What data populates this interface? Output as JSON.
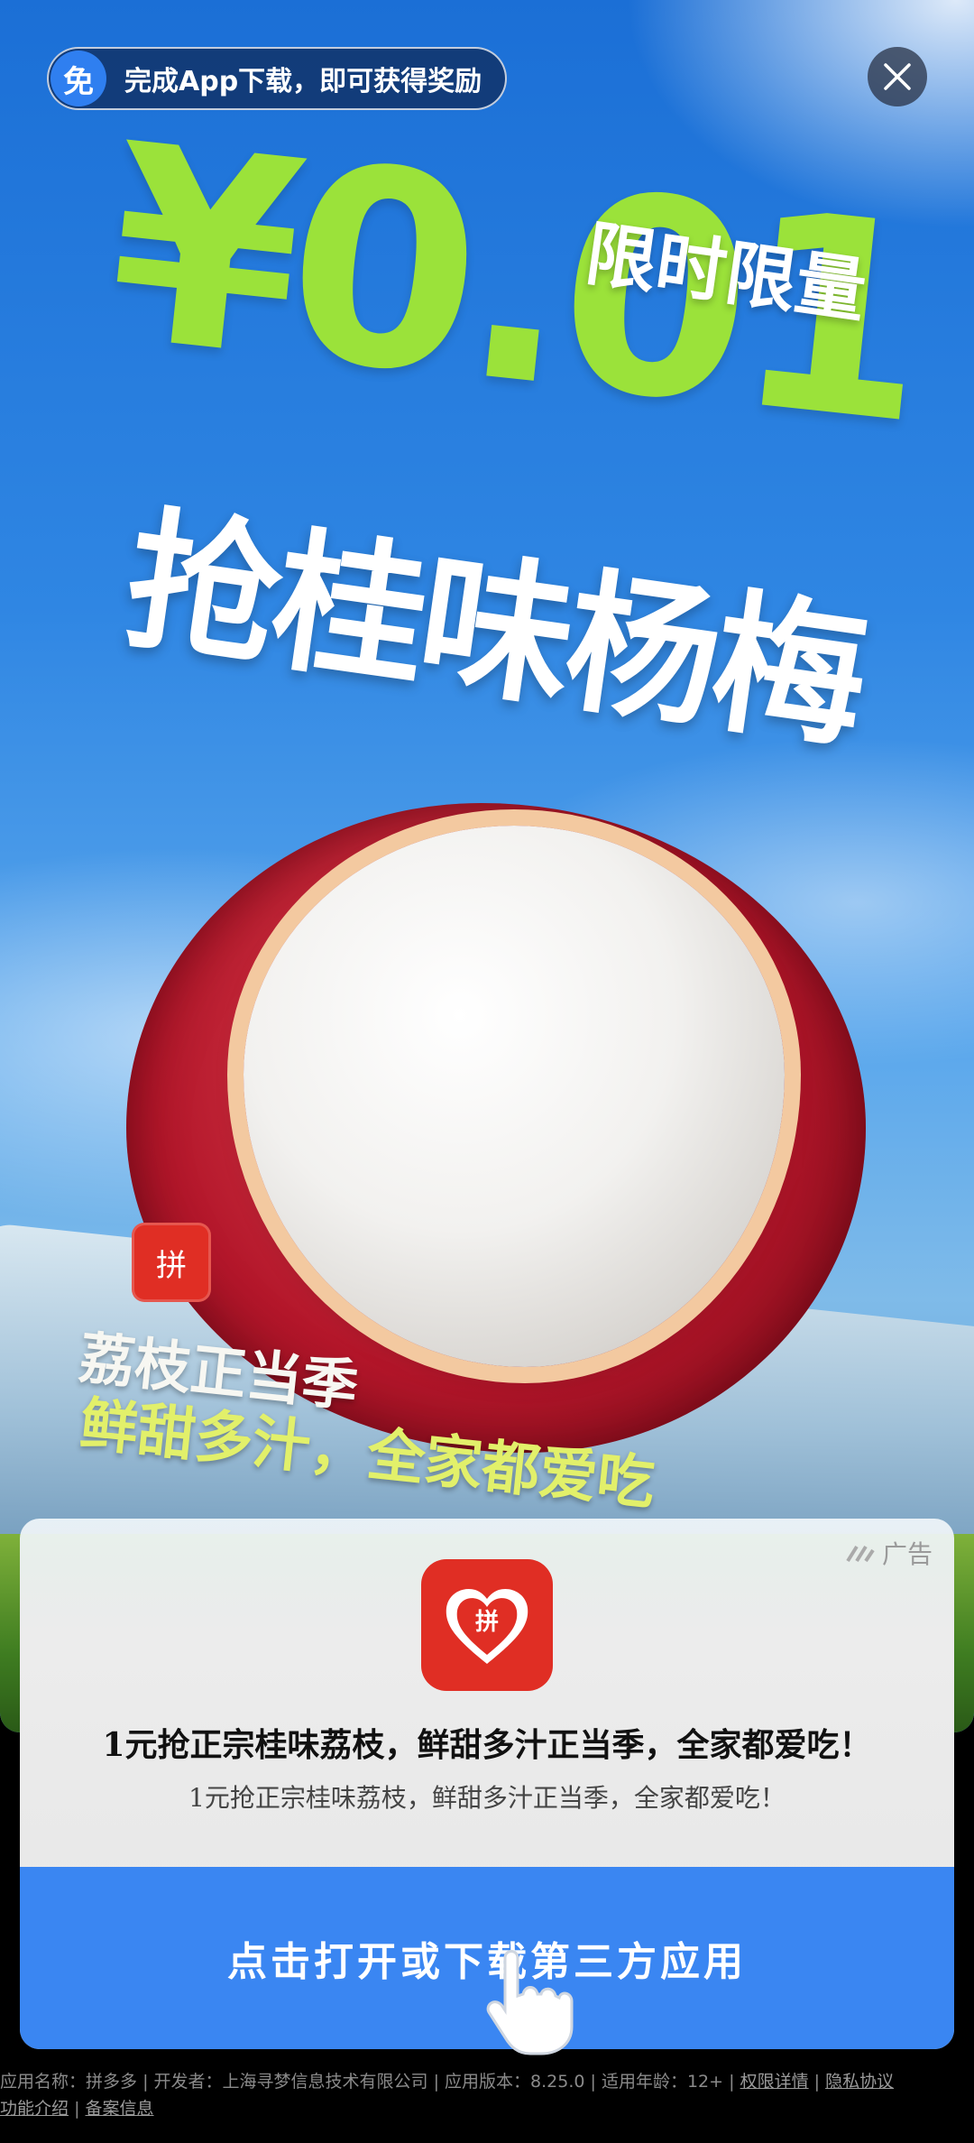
{
  "banner": {
    "badge": "免",
    "text": "完成App下载，即可获得奖励"
  },
  "hero": {
    "price": "¥0.01",
    "limited": "限时限量",
    "headline": "抢桂味杨梅",
    "tag1": "荔枝正当季",
    "tag2": "鲜甜多汁，全家都爱吃",
    "logo_char": "拼"
  },
  "card": {
    "ad_label": "广告",
    "app_icon_char": "拼",
    "title": "1元抢正宗桂味荔枝，鲜甜多汁正当季，全家都爱吃！",
    "subtitle": "1元抢正宗桂味荔枝，鲜甜多汁正当季，全家都爱吃！",
    "cta_label": "点击打开或下载第三方应用"
  },
  "footer": {
    "app_name": "应用名称：拼多多",
    "developer": "开发者：上海寻梦信息技术有限公司",
    "version": "应用版本：8.25.0",
    "age": "适用年龄：12+",
    "permissions": "权限详情",
    "privacy": "隐私协议",
    "features": "功能介绍",
    "filing": "备案信息",
    "separator": "|"
  },
  "colors": {
    "cta": "#3a86f2",
    "brand_red": "#e02e24",
    "price_green": "#9be23a"
  }
}
